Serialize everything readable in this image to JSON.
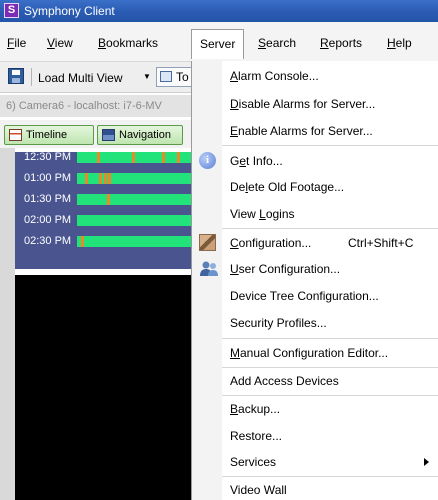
{
  "window": {
    "title": "Symphony Client",
    "icon_letter": "S"
  },
  "menubar": [
    {
      "label": "File",
      "mnemonic": "F",
      "rest": "ile"
    },
    {
      "label": "View",
      "mnemonic": "V",
      "rest": "iew"
    },
    {
      "label": "Bookmarks",
      "mnemonic": "B",
      "rest": "ookmarks"
    },
    {
      "label": "Server",
      "mnemonic": "",
      "rest": "Server"
    },
    {
      "label": "Search",
      "mnemonic": "S",
      "rest": "earch"
    },
    {
      "label": "Reports",
      "mnemonic": "R",
      "rest": "eports"
    },
    {
      "label": "Help",
      "mnemonic": "H",
      "rest": "elp"
    }
  ],
  "toolbar": {
    "load_label": "Load Multi View",
    "button_label": "To"
  },
  "camera_label": "6) Camera6 - localhost: i7-6-MV",
  "tabs": {
    "timeline": "Timeline",
    "navigation": "Navigation"
  },
  "timeline": {
    "rows": [
      "12:30 PM",
      "01:00 PM",
      "01:30 PM",
      "02:00 PM",
      "02:30 PM"
    ]
  },
  "server_menu": {
    "alarm_console": {
      "pre": "",
      "mn": "A",
      "post": "larm Console..."
    },
    "disable_alarms": {
      "pre": "",
      "mn": "D",
      "post": "isable Alarms for Server..."
    },
    "enable_alarms": {
      "pre": "",
      "mn": "E",
      "post": "nable Alarms for Server..."
    },
    "get_info": {
      "pre": "G",
      "mn": "e",
      "post": "t Info..."
    },
    "delete_footage": {
      "pre": "De",
      "mn": "l",
      "post": "ete Old Footage..."
    },
    "view_logins": {
      "pre": "View ",
      "mn": "L",
      "post": "ogins"
    },
    "configuration": {
      "pre": "",
      "mn": "C",
      "post": "onfiguration...",
      "shortcut": "Ctrl+Shift+C"
    },
    "user_configuration": {
      "pre": "",
      "mn": "U",
      "post": "ser Configuration..."
    },
    "device_tree": {
      "label": "Device Tree Configuration..."
    },
    "security_profiles": {
      "label": "Security Profiles..."
    },
    "manual_config": {
      "pre": "",
      "mn": "M",
      "post": "anual Configuration Editor..."
    },
    "add_access": {
      "label": "Add Access Devices"
    },
    "backup": {
      "pre": "",
      "mn": "B",
      "post": "ackup..."
    },
    "restore": {
      "label": "Restore..."
    },
    "services": {
      "label": "Services"
    },
    "video_wall": {
      "label": "Video Wall"
    }
  },
  "colors": {
    "titlebar": "#2a5bb3",
    "timeline_bg": "#4a5590",
    "recording": "#22e37a",
    "event": "#e8892a"
  }
}
